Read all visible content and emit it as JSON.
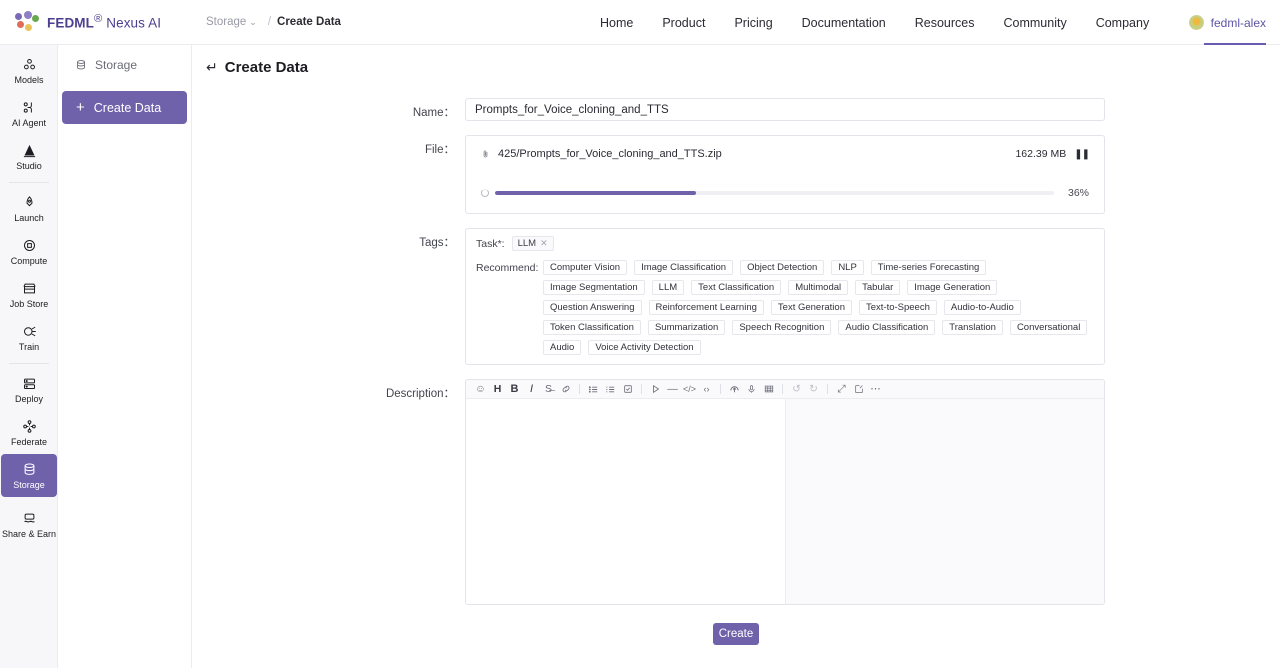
{
  "brand": {
    "name_bold": "FEDML",
    "reg": "®",
    "name_sub": " Nexus AI"
  },
  "breadcrumb": {
    "root": "Storage",
    "caret": "⌄",
    "separator": "/",
    "current": "Create Data"
  },
  "topnav": {
    "items": [
      {
        "label": "Home"
      },
      {
        "label": "Product"
      },
      {
        "label": "Pricing"
      },
      {
        "label": "Documentation"
      },
      {
        "label": "Resources"
      },
      {
        "label": "Community"
      },
      {
        "label": "Company"
      }
    ]
  },
  "user": {
    "name": "fedml-alex"
  },
  "rail": {
    "items": [
      {
        "label": "Models",
        "icon": "models-icon",
        "active": false
      },
      {
        "label": "AI Agent",
        "icon": "ai-agent-icon",
        "active": false
      },
      {
        "label": "Studio",
        "icon": "studio-icon",
        "active": false
      },
      {
        "label": "Launch",
        "icon": "launch-icon",
        "active": false
      },
      {
        "label": "Compute",
        "icon": "compute-icon",
        "active": false
      },
      {
        "label": "Job Store",
        "icon": "job-store-icon",
        "active": false
      },
      {
        "label": "Train",
        "icon": "train-icon",
        "active": false
      },
      {
        "label": "Deploy",
        "icon": "deploy-icon",
        "active": false
      },
      {
        "label": "Federate",
        "icon": "federate-icon",
        "active": false
      },
      {
        "label": "Storage",
        "icon": "storage-icon",
        "active": true
      },
      {
        "label": "Share & Earn",
        "icon": "share-earn-icon",
        "active": false
      }
    ]
  },
  "sidebar": {
    "storage_label": "Storage",
    "create_data_label": "Create Data",
    "create_plus": "+"
  },
  "page": {
    "back_arrow": "↵",
    "title": "Create Data"
  },
  "form": {
    "name": {
      "label": "Name：",
      "value": "Prompts_for_Voice_cloning_and_TTS",
      "placeholder": ""
    },
    "file": {
      "label": "File：",
      "file_name": "425/Prompts_for_Voice_cloning_and_TTS.zip",
      "file_size": "162.39 MB",
      "pause_glyph": "❚❚",
      "progress_percent": 36,
      "progress_label": "36%"
    },
    "tags": {
      "label": "Tags：",
      "task_key": "Task*:",
      "selected": [
        {
          "label": "LLM",
          "remove": "✕"
        }
      ],
      "recommend_label": "Recommend:",
      "recommend": [
        "Computer Vision",
        "Image Classification",
        "Object Detection",
        "NLP",
        "Time-series Forecasting",
        "Image Segmentation",
        "LLM",
        "Text Classification",
        "Multimodal",
        "Tabular",
        "Image Generation",
        "Question Answering",
        "Reinforcement Learning",
        "Text Generation",
        "Text-to-Speech",
        "Audio-to-Audio",
        "Token Classification",
        "Summarization",
        "Speech Recognition",
        "Audio Classification",
        "Translation",
        "Conversational",
        "Audio",
        "Voice Activity Detection"
      ]
    },
    "description": {
      "label": "Description：",
      "value": "",
      "toolbar": [
        {
          "name": "emoji-icon",
          "glyph": "☺"
        },
        {
          "name": "heading-icon",
          "glyph": "H"
        },
        {
          "name": "bold-icon",
          "glyph": "B"
        },
        {
          "name": "italic-icon",
          "glyph": "I"
        },
        {
          "name": "strikethrough-icon",
          "glyph": "S"
        },
        {
          "name": "link-icon",
          "glyph": "🔗"
        },
        {
          "name": "unordered-list-icon",
          "glyph": "☰"
        },
        {
          "name": "ordered-list-icon",
          "glyph": "☰"
        },
        {
          "name": "checklist-icon",
          "glyph": "☑"
        },
        {
          "name": "quote-icon",
          "glyph": "▷"
        },
        {
          "name": "horizontal-rule-icon",
          "glyph": "—"
        },
        {
          "name": "inline-code-icon",
          "glyph": "</>"
        },
        {
          "name": "code-block-icon",
          "glyph": "‹›"
        },
        {
          "name": "upload-icon",
          "glyph": "⌒"
        },
        {
          "name": "microphone-icon",
          "glyph": "🎤"
        },
        {
          "name": "table-icon",
          "glyph": "▦"
        },
        {
          "name": "undo-icon",
          "glyph": "↺"
        },
        {
          "name": "redo-icon",
          "glyph": "↻"
        },
        {
          "name": "fullscreen-icon",
          "glyph": "⤢"
        },
        {
          "name": "edit-mode-icon",
          "glyph": "✎"
        },
        {
          "name": "more-options-icon",
          "glyph": "⋯"
        }
      ]
    }
  },
  "actions": {
    "create_label": "Create"
  },
  "colors": {
    "accent": "#6f62ab",
    "brand_text": "#4b3f8f",
    "rail_bg": "#f7f7fa",
    "border": "#e3e3e9",
    "progress_fill": "#6f62ab"
  }
}
